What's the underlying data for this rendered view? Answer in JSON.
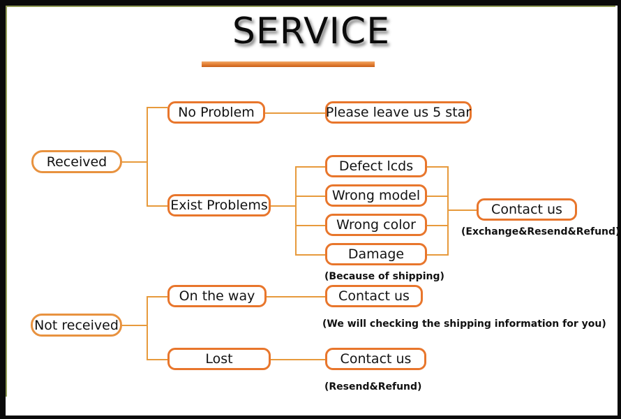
{
  "title": {
    "text": "SERVICE"
  },
  "nodes": {
    "received": "Received",
    "no_problem": "No Problem",
    "please_leave": "Please leave us 5 star",
    "exist_problems": "Exist Problems",
    "defect_lcds": "Defect lcds",
    "wrong_model": "Wrong model",
    "wrong_color": "Wrong color",
    "damage": "Damage",
    "contact_us_problems": "Contact us",
    "not_received": "Not received",
    "on_the_way": "On the way",
    "lost": "Lost",
    "contact_us_on_the_way": "Contact us",
    "contact_us_lost": "Contact us"
  },
  "captions": {
    "exchange_resend_refund": "(Exchange&Resend&Refund)",
    "because_of_shipping": "(Because of shipping)",
    "checking_shipping_info": "(We will checking the shipping information for you)",
    "resend_refund": "(Resend&Refund)"
  },
  "colors": {
    "node_border": "#e8762c",
    "soft_node_border": "#e8923f",
    "connector": "#e79a3c",
    "title_rule": "#e7853a",
    "frame": "#0a0a0a",
    "frame_inner": "#8f9a54",
    "text": "#121212"
  }
}
